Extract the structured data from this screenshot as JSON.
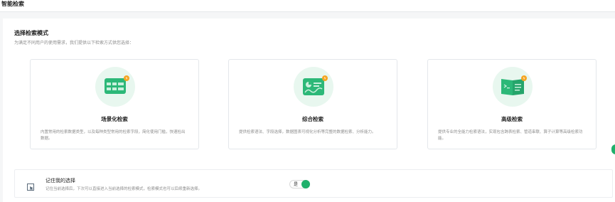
{
  "page": {
    "title": "智能检索"
  },
  "section": {
    "title": "选择检索模式",
    "description": "为满足不同用户的使用需求，我们提供以下检索方式供您选择："
  },
  "cards": [
    {
      "title": "场景化检索",
      "description": "内置常用的检索数据类型，以及每种类型常用的检索字段，简化使用门槛，快速检出数据。",
      "icon": "scenario-grid-icon"
    },
    {
      "title": "综合检索",
      "description": "提供检索语法、字段选择，数据图表可视化分析等完整的数据检索、分析能力。",
      "icon": "dashboard-chart-icon"
    },
    {
      "title": "高级检索",
      "description": "提供专业的全能力检索语法，实现包含跨表检索、管道串联、算子计算等高级检索功能。",
      "icon": "terminal-book-icon"
    }
  ],
  "remember": {
    "title": "记住我的选择",
    "description": "记住当前选择后，下次可以直接进入当前选择的检索模式，检索模式也可以后续重新选择。",
    "toggle_label": "是",
    "toggle_on": true
  },
  "colors": {
    "accent": "#1fb06b",
    "icon_bg": "#e8f7ef",
    "badge": "#f5a623"
  }
}
